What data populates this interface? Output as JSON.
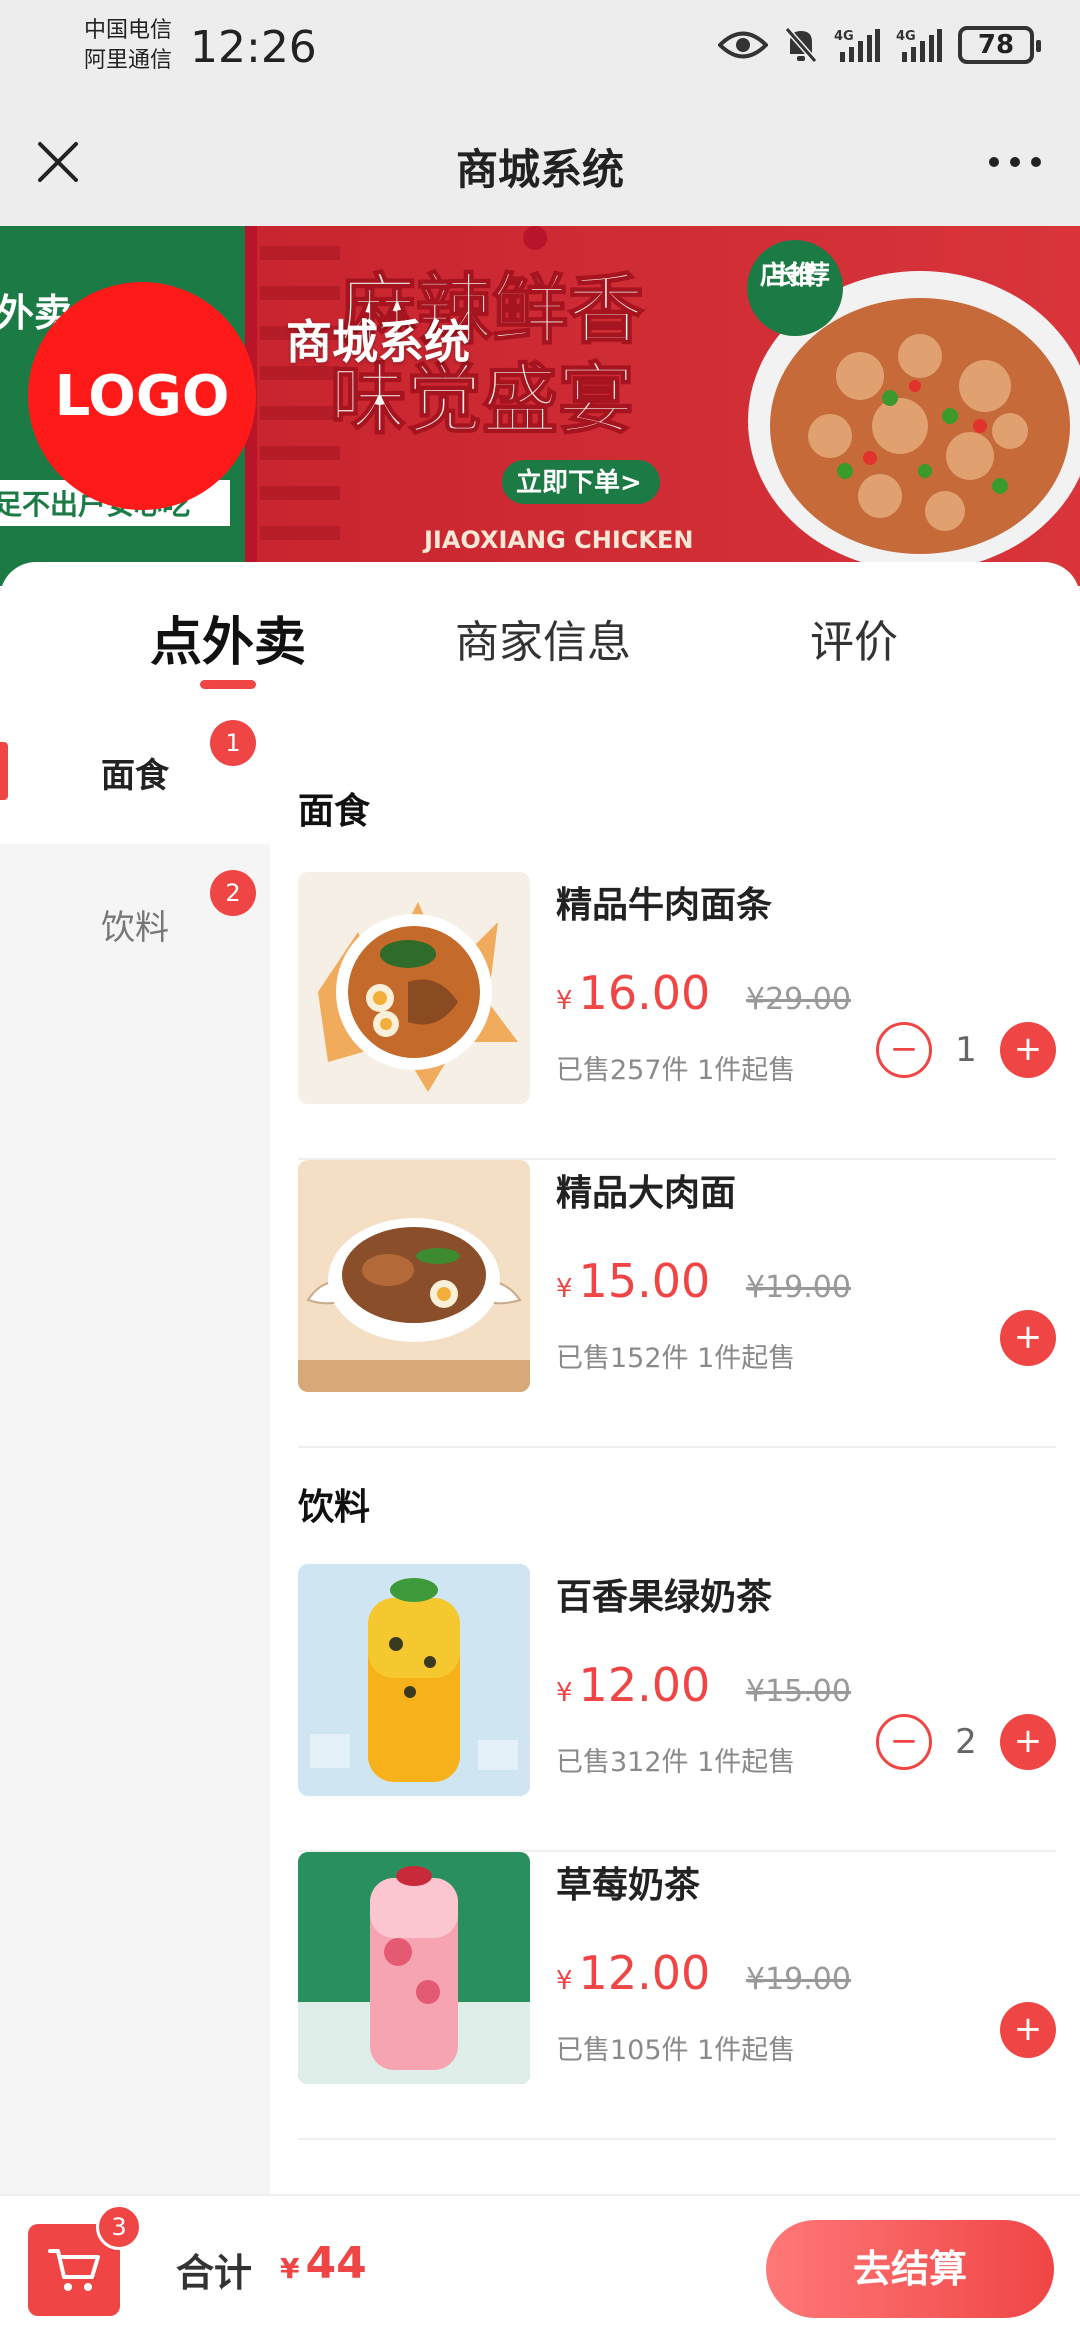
{
  "status_bar": {
    "carrier_1": "中国电信",
    "carrier_2": "阿里通信",
    "time": "12:26",
    "battery": "78"
  },
  "nav": {
    "title": "商城系统",
    "close_icon": "close-icon",
    "more_icon": "more-icon"
  },
  "banner": {
    "logo_text": "LOGO",
    "shop_name": "商城系统",
    "headline_1": "麻辣鲜香",
    "headline_2": "味觉盛宴",
    "tag": "店长推荐",
    "cta": "立即下单>",
    "brand": "JIAOXIANG CHICKEN",
    "left_text": "外卖",
    "left_bottom": "足不出户安心吃"
  },
  "tabs": [
    {
      "label": "点外卖",
      "active": true
    },
    {
      "label": "商家信息",
      "active": false
    },
    {
      "label": "评价",
      "active": false
    }
  ],
  "categories": [
    {
      "label": "面食",
      "badge": "1",
      "active": true
    },
    {
      "label": "饮料",
      "badge": "2",
      "active": false
    }
  ],
  "sections": [
    {
      "title": "面食",
      "products": [
        {
          "name": "精品牛肉面条",
          "currency": "¥",
          "price": "16.00",
          "old_price": "¥29.00",
          "sold": "已售257件 1件起售",
          "qty": "1",
          "minus": "−",
          "plus": "+"
        },
        {
          "name": "精品大肉面",
          "currency": "¥",
          "price": "15.00",
          "old_price": "¥19.00",
          "sold": "已售152件 1件起售",
          "qty": "",
          "minus": "−",
          "plus": "+"
        }
      ]
    },
    {
      "title": "饮料",
      "products": [
        {
          "name": "百香果绿奶茶",
          "currency": "¥",
          "price": "12.00",
          "old_price": "¥15.00",
          "sold": "已售312件 1件起售",
          "qty": "2",
          "minus": "−",
          "plus": "+"
        },
        {
          "name": "草莓奶茶",
          "currency": "¥",
          "price": "12.00",
          "old_price": "¥19.00",
          "sold": "已售105件 1件起售",
          "qty": "",
          "minus": "−",
          "plus": "+"
        }
      ]
    }
  ],
  "bottom": {
    "cart_count": "3",
    "total_label": "合计",
    "currency": "¥",
    "total": "44",
    "checkout": "去结算"
  },
  "colors": {
    "accent": "#f04545",
    "banner_green": "#1c7a45",
    "banner_red": "#d42a34"
  }
}
